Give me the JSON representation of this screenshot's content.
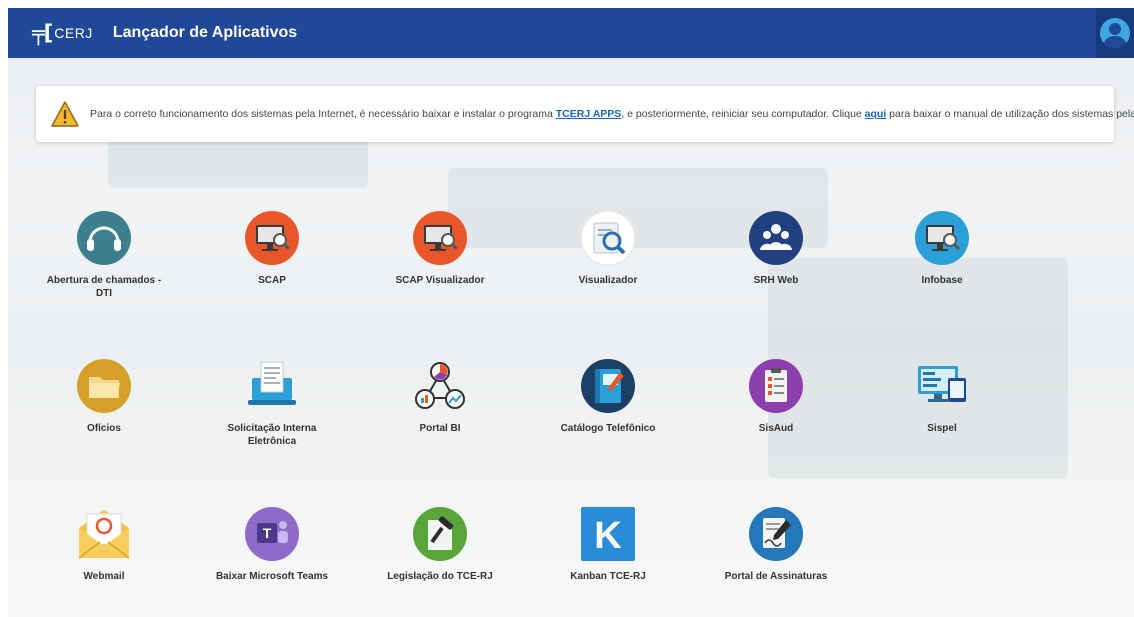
{
  "header": {
    "logo_text": "CERJ",
    "title": "Lançador de Aplicativos"
  },
  "notice": {
    "text_before": "Para o correto funcionamento dos sistemas pela Internet, é necessário baixar e instalar o programa ",
    "link1": "TCERJ APPS",
    "text_middle": ", e posteriormente, reiniciar seu computador. Clique ",
    "link2": "aqui",
    "text_after": " para baixar o manual de utilização dos sistemas pela internet."
  },
  "apps": [
    {
      "label": "Abertura de chamados - DTI",
      "icon": "headset-icon"
    },
    {
      "label": "SCAP",
      "icon": "monitor-search-icon"
    },
    {
      "label": "SCAP Visualizador",
      "icon": "monitor-search-icon"
    },
    {
      "label": "Visualizador",
      "icon": "document-search-icon"
    },
    {
      "label": "SRH Web",
      "icon": "people-icon"
    },
    {
      "label": "Infobase",
      "icon": "monitor-search-icon"
    },
    {
      "label": "Ofícios",
      "icon": "folder-icon"
    },
    {
      "label": "Solicitação Interna Eletrônica",
      "icon": "laptop-document-icon"
    },
    {
      "label": "Portal BI",
      "icon": "bi-charts-icon"
    },
    {
      "label": "Catálogo Telefônico",
      "icon": "phone-book-icon"
    },
    {
      "label": "SisAud",
      "icon": "checklist-icon"
    },
    {
      "label": "Sispel",
      "icon": "computer-screens-icon"
    },
    {
      "label": "Webmail",
      "icon": "mail-icon"
    },
    {
      "label": "Baixar Microsoft Teams",
      "icon": "teams-icon"
    },
    {
      "label": "Legislação do TCE-RJ",
      "icon": "gavel-document-icon"
    },
    {
      "label": "Kanban TCE-RJ",
      "icon": "kanban-icon"
    },
    {
      "label": "Portal de Assinaturas",
      "icon": "signature-icon"
    }
  ],
  "colors": {
    "header": "#1f4896",
    "orange": "#e8562a",
    "teal": "#3d7f8f",
    "navy": "#22407f",
    "sky": "#2a9fd8",
    "purple": "#8e3fae"
  }
}
